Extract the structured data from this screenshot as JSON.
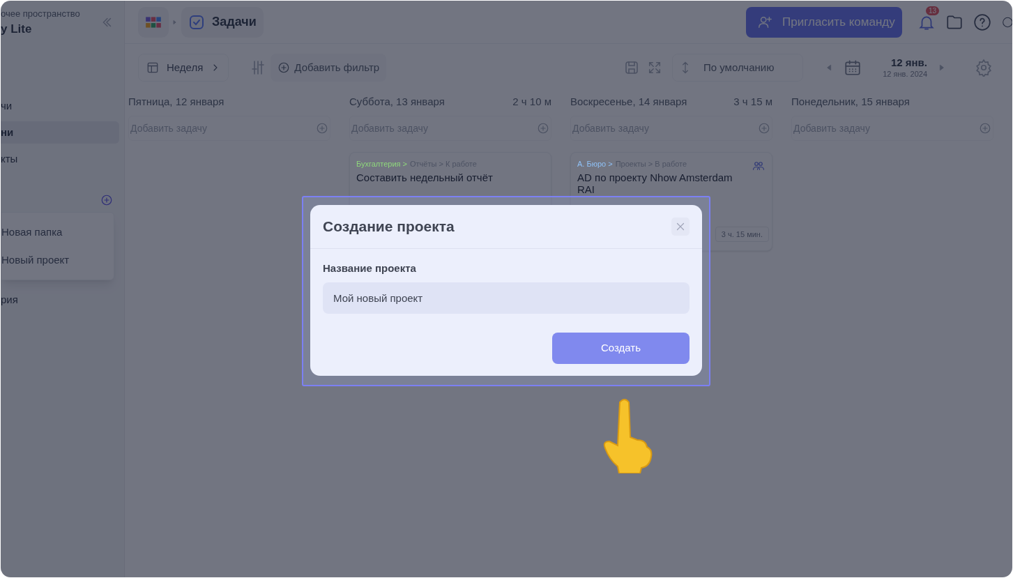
{
  "sidebar": {
    "workspace_label": "очее пространство",
    "workspace_name": "y Lite",
    "items": [
      {
        "label": "чи",
        "selected": false
      },
      {
        "label": "ни",
        "selected": true
      },
      {
        "label": "кты",
        "selected": false
      }
    ],
    "menu": [
      {
        "label": "Новая папка"
      },
      {
        "label": "Новый проект"
      }
    ],
    "footer_item": "рия"
  },
  "topbar": {
    "breadcrumb": "Задачи",
    "invite_button": "Пригласить команду",
    "notification_count": "13"
  },
  "toolbar": {
    "view": "Неделя",
    "add_filter": "Добавить фильтр",
    "sort": "По умолчанию",
    "date": "12 янв.",
    "date_full": "12 янв. 2024"
  },
  "columns": [
    {
      "title": "Пятница, 12 января",
      "add_placeholder": "Добавить задачу"
    },
    {
      "title": "Суббота, 13 января",
      "total": "2 ч 10 м",
      "add_placeholder": "Добавить задачу",
      "cards": [
        {
          "project": "Бухгалтерия >",
          "path": "Отчёты > К работе",
          "color": "#8fd77c",
          "title": "Составить недельный отчёт",
          "shared": false
        }
      ]
    },
    {
      "title": "Воскресенье, 14 января",
      "total": "3 ч 15 м",
      "add_placeholder": "Добавить задачу",
      "cards": [
        {
          "project": "А. Бюро >",
          "path": "Проекты > В работе",
          "color": "#8fc0f5",
          "title": "AD по проекту Nhow Amsterdam RAI",
          "shared": true,
          "duration": "3 ч. 15 мин."
        }
      ]
    },
    {
      "title": "Понедельник, 15 января",
      "add_placeholder": "Добавить задачу"
    }
  ],
  "modal": {
    "title": "Создание проекта",
    "field_label": "Название проекта",
    "field_value": "Мой новый проект",
    "submit": "Создать"
  }
}
